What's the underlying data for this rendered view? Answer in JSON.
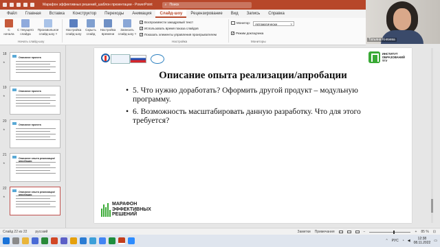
{
  "window": {
    "title": "Марафон эффективных решений_шаблон презентации  -  PowerPoint",
    "search_placeholder": "Поиск"
  },
  "menu": {
    "tabs": [
      "Файл",
      "Главная",
      "Вставка",
      "Конструктор",
      "Переходы",
      "Анимация",
      "Слайд-шоу",
      "Рецензирование",
      "Вид",
      "Запись",
      "Справка"
    ],
    "active": "Слайд-шоу"
  },
  "ribbon": {
    "btn_from_start": "С\nначала",
    "btn_from_current": "С текущего\nслайда",
    "btn_custom": "Произвольное\nслайд-шоу ˅",
    "group_start": "Начать слайд-шоу",
    "btn_setup": "Настройка\nслайд-шоу",
    "btn_hide": "Скрыть\nслайд",
    "btn_rehearse": "Настройка\nвремени",
    "btn_record": "Записать\nслайд-шоу ˅",
    "chk_narration": "Воспроизвести закадровый текст",
    "chk_timings": "Использовать время показа слайдов",
    "chk_controls": "Показать элементы управления проигрывателем",
    "group_setup": "Настройка",
    "monitor_label": "Монитор:",
    "monitor_value": "Автоматически",
    "presenter_view": "Режим докладчика",
    "group_monitors": "Мониторы"
  },
  "webcam": {
    "name": "Татьяна Князева"
  },
  "thumbnails": [
    {
      "num": "18",
      "title": "Описание проекта"
    },
    {
      "num": "19",
      "title": "Описание проекта"
    },
    {
      "num": "20",
      "title": "Описание проекта"
    },
    {
      "num": "21",
      "title": "Описание опыта реализации/апробации"
    },
    {
      "num": "22",
      "title": "Описание опыта реализации/апробации"
    }
  ],
  "slide": {
    "institute_logo_text": "ИНСТИТУТ\nОБРАЗОВАНИЙ\nТГУ",
    "title": "Описание опыта реализации/апробации",
    "bullets": [
      "5. Что нужно доработать? Оформить другой продукт – модульную программу.",
      "6. Возможность масштабировать данную разработку. Что для этого требуется?"
    ],
    "marathon_logo": "МАРАФОН\nЭФФЕКТИВНЫХ\nРЕШЕНИЙ"
  },
  "status": {
    "slide_counter": "Слайд 22 из 22",
    "language": "русский",
    "notes": "Заметки",
    "comments": "Примечания",
    "zoom": "85 %"
  },
  "taskbar": {
    "lang": "РУС",
    "time": "12:38",
    "date": "08.11.2022"
  },
  "colors": {
    "accent": "#b7472a",
    "slide_green": "#39a935"
  }
}
